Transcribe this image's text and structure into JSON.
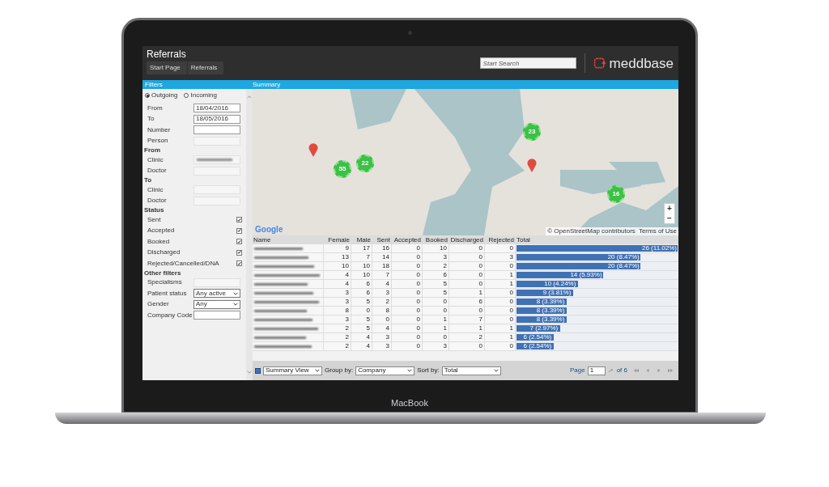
{
  "header": {
    "title": "Referrals",
    "breadcrumbs": [
      "Start Page",
      "Referrals"
    ],
    "search": {
      "placeholder": "Start Search"
    },
    "logo": "meddbase"
  },
  "bar": {
    "filters_title": "Filters",
    "summary_title": "Summary"
  },
  "filters": {
    "direction": [
      {
        "label": "Outgoing",
        "selected": true
      },
      {
        "label": "Incoming",
        "selected": false
      }
    ],
    "items": [
      {
        "kind": "field",
        "label": "From",
        "value": "18/04/2016",
        "disabled": false
      },
      {
        "kind": "field",
        "label": "To",
        "value": "18/05/2016",
        "disabled": false
      },
      {
        "kind": "field",
        "label": "Number",
        "disabled": false
      },
      {
        "kind": "field",
        "label": "Person",
        "disabled": true
      },
      {
        "kind": "heading",
        "label": "From"
      },
      {
        "kind": "blurred",
        "label": "Clinic"
      },
      {
        "kind": "field",
        "label": "Doctor",
        "disabled": true
      },
      {
        "kind": "heading",
        "label": "To"
      },
      {
        "kind": "field",
        "label": "Clinic",
        "disabled": true
      },
      {
        "kind": "field",
        "label": "Doctor",
        "disabled": true
      },
      {
        "kind": "heading",
        "label": "Status"
      },
      {
        "kind": "checkbox",
        "label": "Sent",
        "checked": true
      },
      {
        "kind": "checkbox",
        "label": "Accepted",
        "checked": true
      },
      {
        "kind": "checkbox",
        "label": "Booked",
        "checked": true
      },
      {
        "kind": "checkbox",
        "label": "Discharged",
        "checked": true
      },
      {
        "kind": "checkbox",
        "label": "Rejected/Cancelled/DNA",
        "checked": true
      },
      {
        "kind": "heading",
        "label": "Other filters"
      },
      {
        "kind": "field",
        "label": "Specialisms",
        "disabled": true
      },
      {
        "kind": "select",
        "label": "Patient status",
        "value": "Any active"
      },
      {
        "kind": "select",
        "label": "Gender",
        "value": "Any"
      },
      {
        "kind": "field",
        "label": "Company Code",
        "disabled": false
      }
    ]
  },
  "map": {
    "markers": [
      {
        "kind": "pin"
      },
      {
        "kind": "cluster",
        "label": "55"
      },
      {
        "kind": "cluster",
        "label": "22"
      },
      {
        "kind": "cluster",
        "label": "23"
      },
      {
        "kind": "pin"
      },
      {
        "kind": "cluster",
        "label": "16"
      }
    ],
    "zoom": [
      "+",
      "−"
    ],
    "google": "Google",
    "attribution": "© OpenStreetMap contributors",
    "terms": "Terms of Use"
  },
  "table": {
    "name_column": "Name",
    "columns": [
      "Female",
      "Male",
      "Sent",
      "Accepted",
      "Booked",
      "Discharged",
      "Rejected",
      "Total"
    ],
    "rows": [
      {
        "cells": [
          "9",
          "17",
          "16",
          "0",
          "10",
          "0",
          "0"
        ],
        "total": "26 (11.02%)",
        "level": 1
      },
      {
        "cells": [
          "13",
          "7",
          "14",
          "0",
          "3",
          "0",
          "3"
        ],
        "total": "20 (8.47%)",
        "level": 0.77
      },
      {
        "cells": [
          "10",
          "10",
          "18",
          "0",
          "2",
          "0",
          "0"
        ],
        "total": "20 (8.47%)",
        "level": 0.77
      },
      {
        "cells": [
          "4",
          "10",
          "7",
          "0",
          "6",
          "0",
          "1"
        ],
        "total": "14 (5.93%)",
        "level": 0.54
      },
      {
        "cells": [
          "4",
          "6",
          "4",
          "0",
          "5",
          "0",
          "1"
        ],
        "total": "10 (4.24%)",
        "level": 0.38
      },
      {
        "cells": [
          "3",
          "6",
          "3",
          "0",
          "5",
          "1",
          "0"
        ],
        "total": "9 (3.81%)",
        "level": 0.35
      },
      {
        "cells": [
          "3",
          "5",
          "2",
          "0",
          "0",
          "6",
          "0"
        ],
        "total": "8 (3.39%)",
        "level": 0.31
      },
      {
        "cells": [
          "8",
          "0",
          "8",
          "0",
          "0",
          "0",
          "0"
        ],
        "total": "8 (3.39%)",
        "level": 0.31
      },
      {
        "cells": [
          "3",
          "5",
          "0",
          "0",
          "1",
          "7",
          "0"
        ],
        "total": "8 (3.39%)",
        "level": 0.31
      },
      {
        "cells": [
          "2",
          "5",
          "4",
          "0",
          "1",
          "1",
          "1"
        ],
        "total": "7 (2.97%)",
        "level": 0.27
      },
      {
        "cells": [
          "2",
          "4",
          "3",
          "0",
          "0",
          "2",
          "1"
        ],
        "total": "6 (2.54%)",
        "level": 0.23
      },
      {
        "cells": [
          "2",
          "4",
          "3",
          "0",
          "3",
          "0",
          "0"
        ],
        "total": "6 (2.54%)",
        "level": 0.23
      }
    ]
  },
  "footer": {
    "view": "Summary View",
    "group_label": "Group by:",
    "group": "Company",
    "sort_label": "Sort by:",
    "sort": "Total",
    "page_label": "Page",
    "page": "1",
    "of": "of 6"
  },
  "device": {
    "label": "MacBook"
  }
}
